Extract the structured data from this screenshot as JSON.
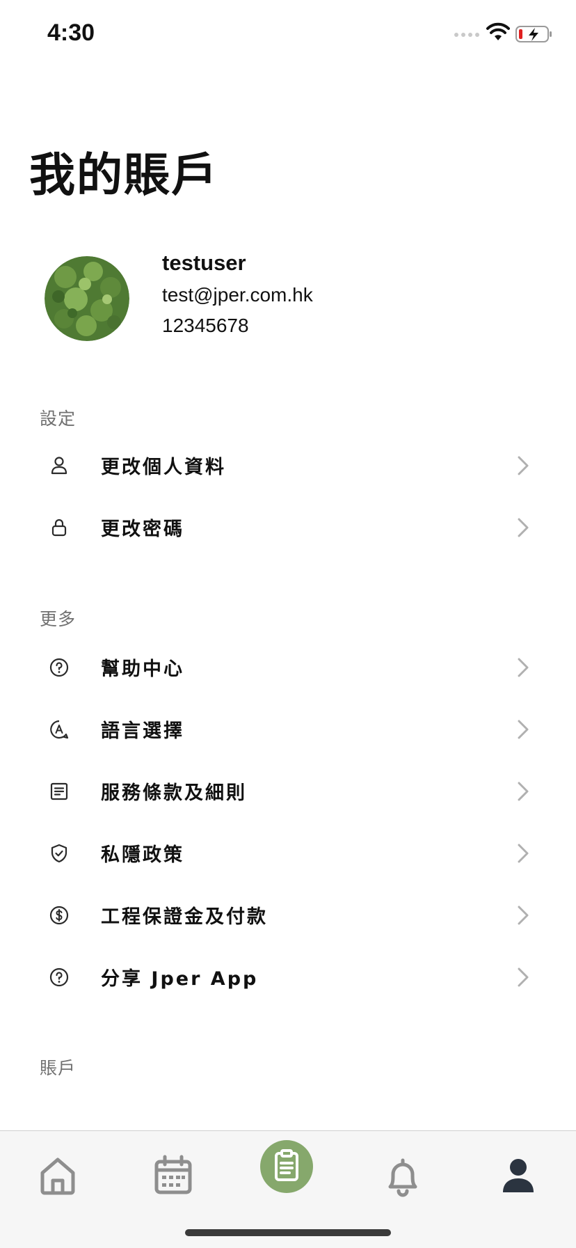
{
  "status_bar": {
    "time": "4:30"
  },
  "page_title": "我的賬戶",
  "profile": {
    "name": "testuser",
    "email": "test@jper.com.hk",
    "phone": "12345678"
  },
  "sections": {
    "settings": {
      "label": "設定",
      "items": [
        {
          "label": "更改個人資料",
          "icon": "person-icon"
        },
        {
          "label": "更改密碼",
          "icon": "lock-icon"
        }
      ]
    },
    "more": {
      "label": "更多",
      "items": [
        {
          "label": "幫助中心",
          "icon": "help-icon"
        },
        {
          "label": "語言選擇",
          "icon": "language-icon"
        },
        {
          "label": "服務條款及細則",
          "icon": "document-icon"
        },
        {
          "label": "私隱政策",
          "icon": "shield-icon"
        },
        {
          "label": "工程保證金及付款",
          "icon": "dollar-icon"
        },
        {
          "label": "分享 Jper App",
          "icon": "share-help-icon"
        }
      ]
    },
    "account": {
      "label": "賬戶"
    }
  },
  "tab_bar": {
    "tabs": [
      "home-icon",
      "calendar-icon",
      "clipboard-icon",
      "bell-icon",
      "user-icon"
    ],
    "active_tab": "user-icon",
    "accent_color": "#86a86c"
  }
}
